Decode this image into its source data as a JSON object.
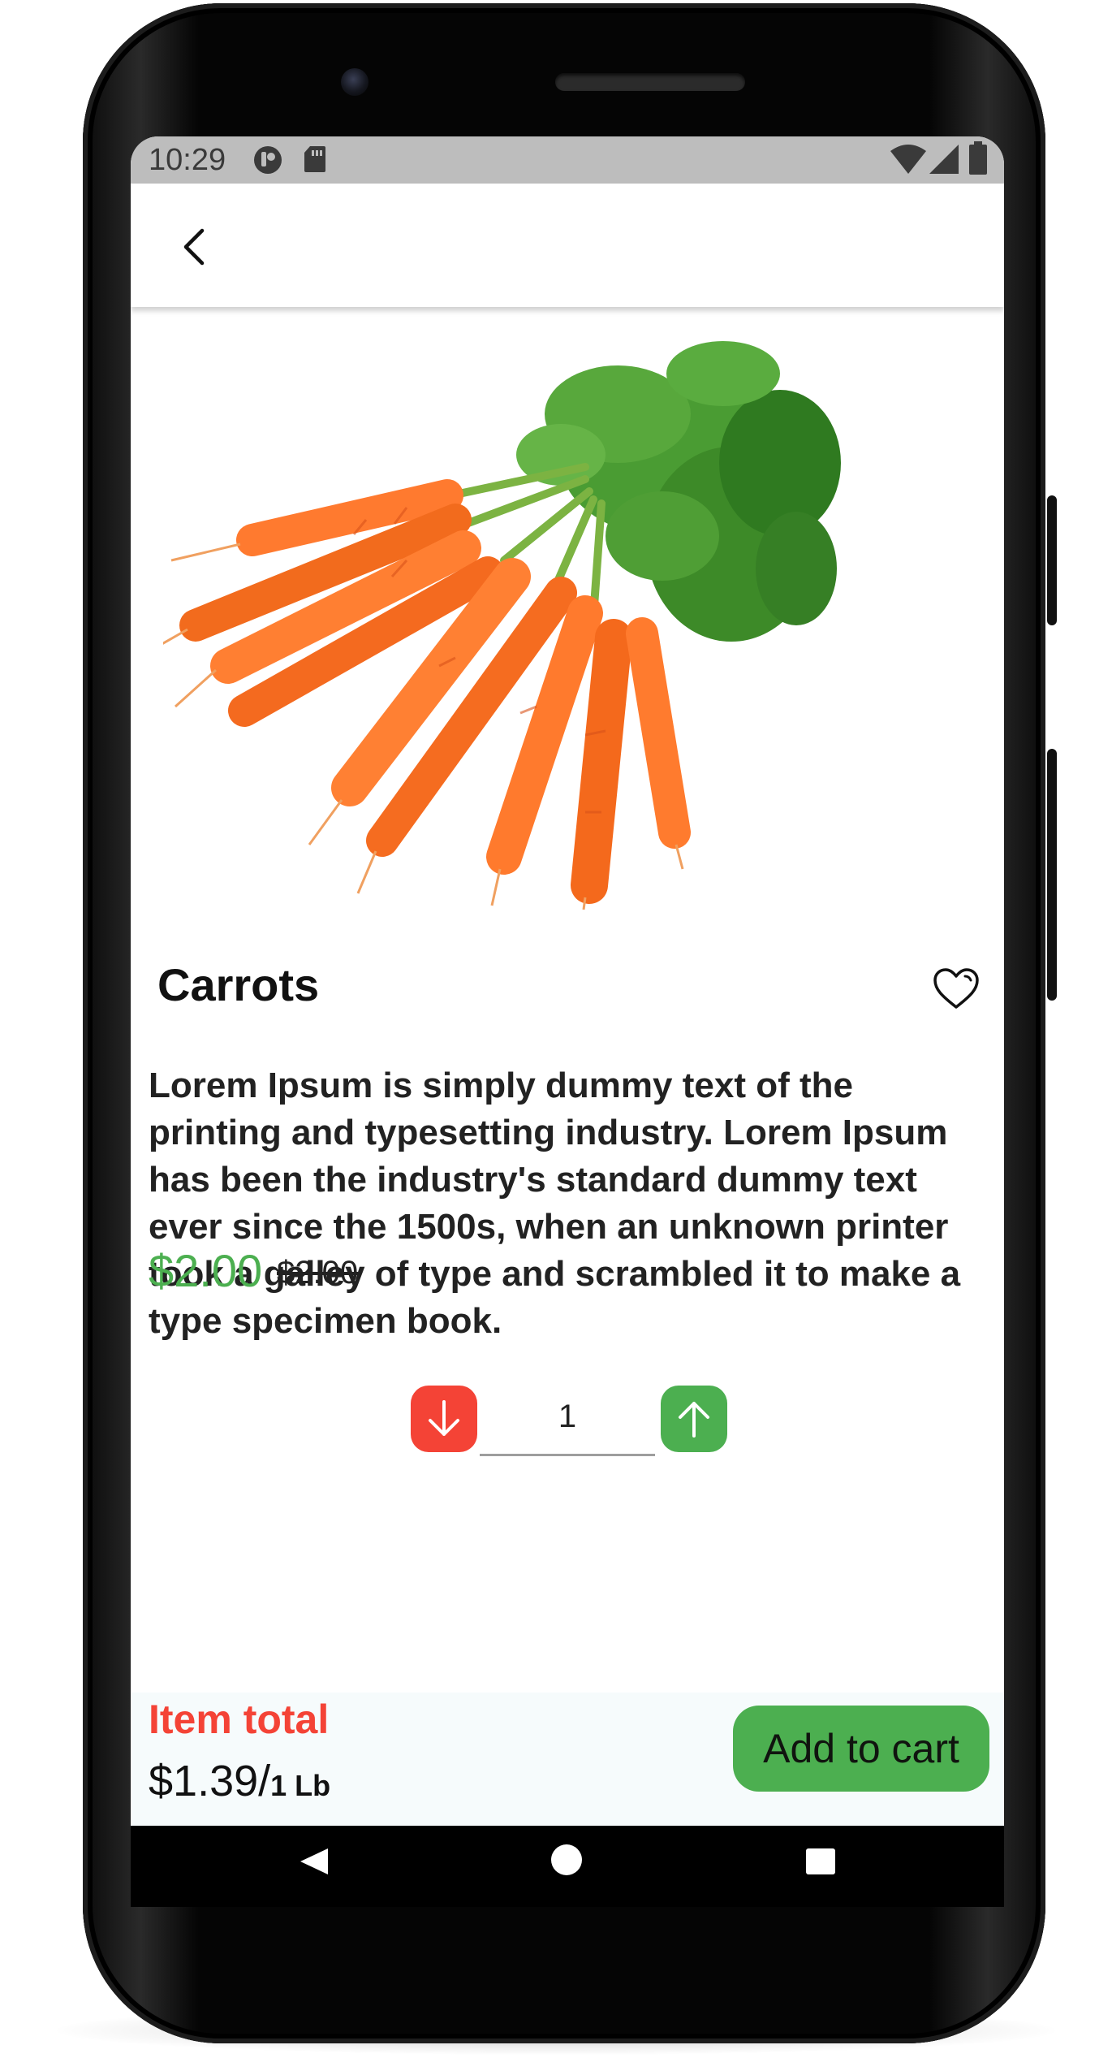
{
  "status_bar": {
    "time": "10:29",
    "icons": [
      "notification-app-icon",
      "sd-card-icon",
      "wifi-icon",
      "signal-icon",
      "battery-icon"
    ]
  },
  "app_bar": {
    "back_icon": "chevron-left-icon"
  },
  "product": {
    "image_subject": "bunch-of-carrots",
    "title": "Carrots",
    "favorite_icon": "heart-outline-icon",
    "description": "Lorem Ipsum is simply dummy text of the printing and typesetting industry. Lorem Ipsum has been the industry's standard dummy text ever since the 1500s, when an unknown printer took a galley of type and scrambled it to make a type specimen book.",
    "price": "$2.00",
    "original_price": "$2.00"
  },
  "quantity": {
    "value": "1",
    "decrease_icon": "arrow-down-icon",
    "increase_icon": "arrow-up-icon"
  },
  "footer": {
    "total_label": "Item total",
    "total_price": "$1.39/",
    "total_unit": "1 Lb",
    "add_to_cart_label": "Add to cart"
  },
  "nav_bar": {
    "back_icon": "nav-back-icon",
    "home_icon": "nav-home-icon",
    "recents_icon": "nav-recents-icon"
  },
  "colors": {
    "accent_green": "#4caf50",
    "accent_red": "#f44336",
    "status_bar": "#bdbdbd",
    "footer_bg": "#f6fbfc"
  }
}
